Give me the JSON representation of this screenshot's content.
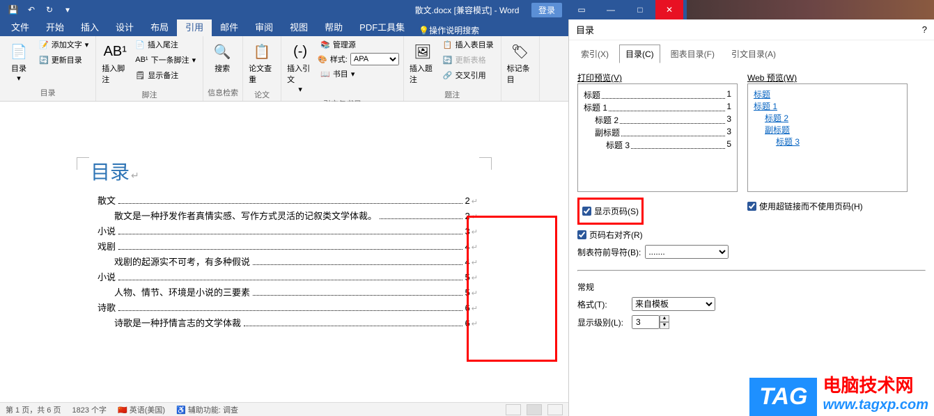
{
  "titlebar": {
    "title": "散文.docx [兼容模式] - Word",
    "login": "登录"
  },
  "tabs": {
    "file": "文件",
    "home": "开始",
    "insert": "插入",
    "design": "设计",
    "layout": "布局",
    "references": "引用",
    "mailings": "邮件",
    "review": "审阅",
    "view": "视图",
    "help": "帮助",
    "pdf": "PDF工具集",
    "search": "操作说明搜索"
  },
  "ribbon": {
    "toc": {
      "button": "目录",
      "add_text": "添加文字",
      "update": "更新目录",
      "group": "目录"
    },
    "footnote": {
      "insert": "插入脚注",
      "endnote": "插入尾注",
      "next": "下一条脚注",
      "show": "显示备注",
      "group": "脚注"
    },
    "research": {
      "search": "搜索",
      "group": "信息检索"
    },
    "citation": {
      "lookup": "论文查重",
      "group": "论文"
    },
    "cite": {
      "insert": "插入引文",
      "manage": "管理源",
      "style_label": "样式:",
      "style_value": "APA",
      "biblio": "书目",
      "group": "引文与书目"
    },
    "caption": {
      "insert": "插入题注",
      "insert_toc": "插入表目录",
      "update": "更新表格",
      "cross": "交叉引用",
      "group": "题注"
    },
    "entry": {
      "mark": "标记条目"
    }
  },
  "document": {
    "toc_title": "目录",
    "entries": [
      {
        "lvl": 1,
        "text": "散文",
        "page": "2"
      },
      {
        "lvl": 2,
        "text": "散文是一种抒发作者真情实感、写作方式灵活的记叙类文学体裁。",
        "page": "2"
      },
      {
        "lvl": 1,
        "text": "小说",
        "page": "3"
      },
      {
        "lvl": 1,
        "text": "戏剧",
        "page": "4"
      },
      {
        "lvl": 2,
        "text": "戏剧的起源实不可考，有多种假说",
        "page": "4"
      },
      {
        "lvl": 1,
        "text": "小说",
        "page": "5"
      },
      {
        "lvl": 2,
        "text": "人物、情节、环境是小说的三要素",
        "page": "5"
      },
      {
        "lvl": 1,
        "text": "诗歌",
        "page": "6"
      },
      {
        "lvl": 2,
        "text": "诗歌是一种抒情言志的文学体裁",
        "page": "6"
      }
    ]
  },
  "dialog": {
    "title": "目录",
    "help": "?",
    "tab_index": "索引(X)",
    "tab_toc": "目录(C)",
    "tab_figures": "图表目录(F)",
    "tab_citations": "引文目录(A)",
    "print_preview_label": "打印预览(V)",
    "web_preview_label": "Web 预览(W)",
    "print_preview": [
      {
        "indent": 0,
        "text": "标题",
        "page": "1"
      },
      {
        "indent": 0,
        "text": "标题 1",
        "page": "1"
      },
      {
        "indent": 1,
        "text": "标题 2",
        "page": "3"
      },
      {
        "indent": 1,
        "text": "副标题",
        "page": "3"
      },
      {
        "indent": 2,
        "text": "标题 3",
        "page": "5"
      }
    ],
    "web_preview": [
      {
        "indent": 0,
        "text": "标题"
      },
      {
        "indent": 0,
        "text": "标题 1"
      },
      {
        "indent": 1,
        "text": "标题 2"
      },
      {
        "indent": 1,
        "text": "副标题"
      },
      {
        "indent": 2,
        "text": "标题 3"
      }
    ],
    "show_page_numbers": "显示页码(S)",
    "right_align": "页码右对齐(R)",
    "use_hyperlinks": "使用超链接而不使用页码(H)",
    "tab_leader_label": "制表符前导符(B):",
    "tab_leader_value": ".......",
    "general_label": "常规",
    "format_label": "格式(T):",
    "format_value": "来自模板",
    "levels_label": "显示级别(L):",
    "levels_value": "3"
  },
  "statusbar": {
    "page": "第 1 页，共 6 页",
    "words": "1823 个字",
    "lang": "英语(美国)",
    "a11y": "辅助功能: 调查"
  },
  "watermark": {
    "tag": "TAG",
    "cn": "电脑技术网",
    "url": "www.tagxp.com"
  }
}
